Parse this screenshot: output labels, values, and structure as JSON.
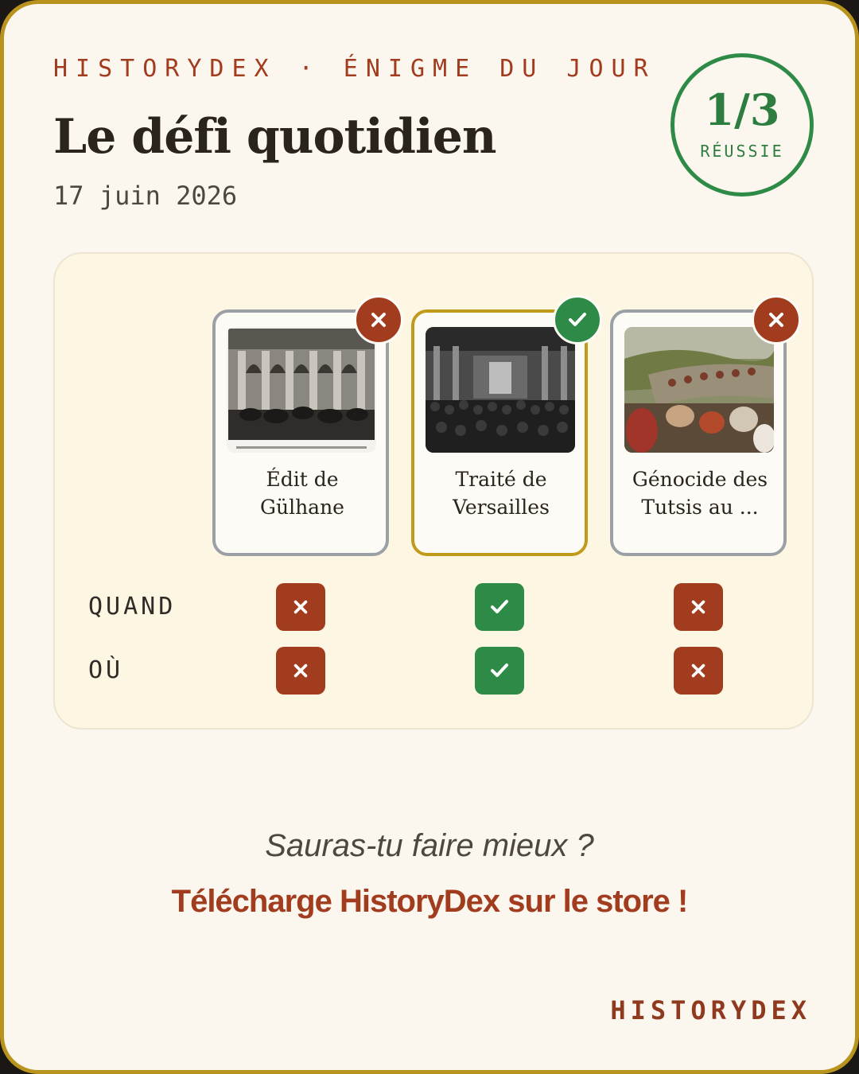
{
  "header": {
    "kicker": "HISTORYDEX · ÉNIGME DU JOUR",
    "title": "Le défi quotidien",
    "date": "17 juin 2026"
  },
  "score": {
    "value": "1/3",
    "label": "RÉUSSIE",
    "color": "#2e8b47"
  },
  "cards": [
    {
      "title": "Édit de Gülhane",
      "status": "incorrect",
      "image_description": "engraving-grand-hall",
      "quand": "incorrect",
      "ou": "incorrect"
    },
    {
      "title": "Traité de Versailles",
      "status": "correct",
      "image_description": "photo-hall-of-mirrors-crowd",
      "quand": "correct",
      "ou": "correct"
    },
    {
      "title": "Génocide des Tutsis au ...",
      "status": "incorrect",
      "image_description": "photo-refugee-column",
      "quand": "incorrect",
      "ou": "incorrect"
    }
  ],
  "rows": {
    "quand_label": "QUAND",
    "ou_label": "OÙ"
  },
  "icons": {
    "incorrect": "close-icon",
    "correct": "check-icon"
  },
  "footer": {
    "prompt": "Sauras-tu faire mieux ?",
    "cta": "Télécharge HistoryDex sur le store !",
    "brand": "HISTORYDEX"
  },
  "colors": {
    "accent_red": "#a23c1f",
    "accent_green": "#2e8b47",
    "gold_border": "#b8941f",
    "background": "#fbf7ee"
  }
}
